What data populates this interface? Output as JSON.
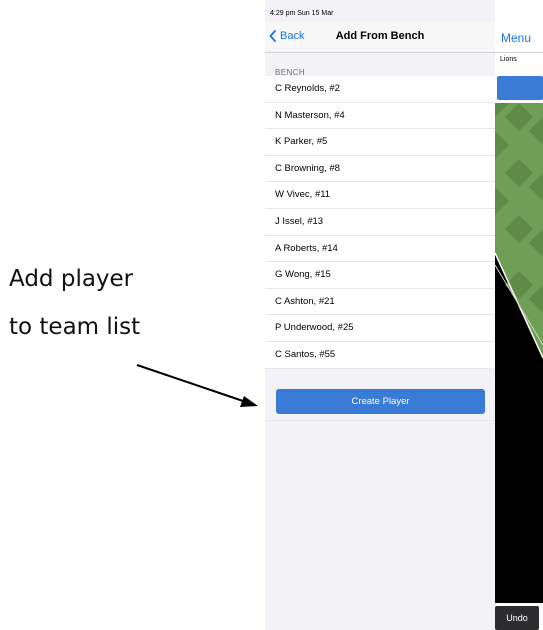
{
  "annotation": {
    "line1": "Add player",
    "line2": "to team list"
  },
  "status_bar": {
    "time": "4:29 pm  Sun 15 Mar"
  },
  "nav": {
    "back_label": "Back",
    "title": "Add From Bench"
  },
  "bench": {
    "header": "BENCH",
    "players": [
      "C Reynolds, #2",
      "N Masterson, #4",
      "K Parker, #5",
      "C Browning, #8",
      "W Vivec, #11",
      "J Issel, #13",
      "A Roberts, #14",
      "G Wong, #15",
      "C Ashton, #21",
      "P Underwood, #25",
      "C Santos, #55"
    ],
    "create_label": "Create Player"
  },
  "right_panel": {
    "menu_label": "Menu",
    "team_label": "Lions",
    "undo_label": "Undo"
  },
  "colors": {
    "accent": "#1a73e8",
    "button_blue": "#3a7bd5",
    "field_green_light": "#6f9f56",
    "field_green_dark": "#5e8c47"
  }
}
